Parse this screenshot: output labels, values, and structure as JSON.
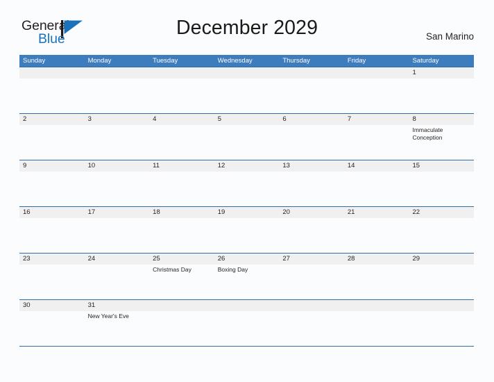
{
  "brand": {
    "name_part1": "General",
    "name_part2": "Blue",
    "flag_icon": "flag-triangle-icon",
    "accent_color": "#1a72ba"
  },
  "header": {
    "title": "December 2029",
    "location": "San Marino"
  },
  "theme": {
    "header_blue": "#3d7cbd",
    "rule_blue": "#2e6da4",
    "strip_gray": "#f0f0f0",
    "page_background": "#fbfcfd",
    "text_color": "#231f20"
  },
  "calendar": {
    "month": "December",
    "year": "2029",
    "weekday_headers": [
      "Sunday",
      "Monday",
      "Tuesday",
      "Wednesday",
      "Thursday",
      "Friday",
      "Saturday"
    ],
    "weeks": [
      {
        "days": [
          {
            "number": "",
            "events": []
          },
          {
            "number": "",
            "events": []
          },
          {
            "number": "",
            "events": []
          },
          {
            "number": "",
            "events": []
          },
          {
            "number": "",
            "events": []
          },
          {
            "number": "",
            "events": []
          },
          {
            "number": "1",
            "events": []
          }
        ]
      },
      {
        "days": [
          {
            "number": "2",
            "events": []
          },
          {
            "number": "3",
            "events": []
          },
          {
            "number": "4",
            "events": []
          },
          {
            "number": "5",
            "events": []
          },
          {
            "number": "6",
            "events": []
          },
          {
            "number": "7",
            "events": []
          },
          {
            "number": "8",
            "events": [
              "Immaculate Conception"
            ]
          }
        ]
      },
      {
        "days": [
          {
            "number": "9",
            "events": []
          },
          {
            "number": "10",
            "events": []
          },
          {
            "number": "11",
            "events": []
          },
          {
            "number": "12",
            "events": []
          },
          {
            "number": "13",
            "events": []
          },
          {
            "number": "14",
            "events": []
          },
          {
            "number": "15",
            "events": []
          }
        ]
      },
      {
        "days": [
          {
            "number": "16",
            "events": []
          },
          {
            "number": "17",
            "events": []
          },
          {
            "number": "18",
            "events": []
          },
          {
            "number": "19",
            "events": []
          },
          {
            "number": "20",
            "events": []
          },
          {
            "number": "21",
            "events": []
          },
          {
            "number": "22",
            "events": []
          }
        ]
      },
      {
        "days": [
          {
            "number": "23",
            "events": []
          },
          {
            "number": "24",
            "events": []
          },
          {
            "number": "25",
            "events": [
              "Christmas Day"
            ]
          },
          {
            "number": "26",
            "events": [
              "Boxing Day"
            ]
          },
          {
            "number": "27",
            "events": []
          },
          {
            "number": "28",
            "events": []
          },
          {
            "number": "29",
            "events": []
          }
        ]
      },
      {
        "days": [
          {
            "number": "30",
            "events": []
          },
          {
            "number": "31",
            "events": [
              "New Year's Eve"
            ]
          },
          {
            "number": "",
            "events": []
          },
          {
            "number": "",
            "events": []
          },
          {
            "number": "",
            "events": []
          },
          {
            "number": "",
            "events": []
          },
          {
            "number": "",
            "events": []
          }
        ]
      }
    ]
  }
}
